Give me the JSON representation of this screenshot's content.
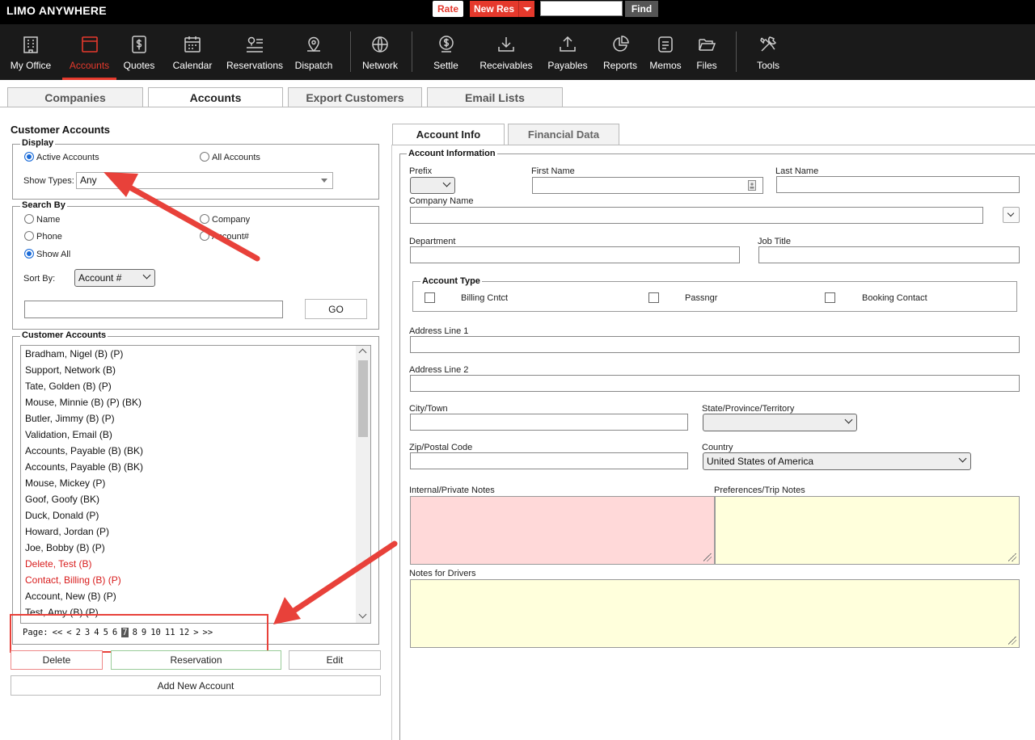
{
  "topbar": {
    "logo": "LIMO ANYWHERE",
    "rate_label": "Rate",
    "new_res_label": "New Res",
    "find_placeholder": "",
    "find_label": "Find"
  },
  "nav": {
    "items": [
      {
        "label": "My Office",
        "icon": "building-icon"
      },
      {
        "label": "Accounts",
        "icon": "accounts-window-icon",
        "active": true
      },
      {
        "label": "Quotes",
        "icon": "dollar-doc-icon"
      },
      {
        "label": "Calendar",
        "icon": "calendar-icon"
      },
      {
        "label": "Reservations",
        "icon": "reservations-list-icon"
      },
      {
        "label": "Dispatch",
        "icon": "location-pin-icon"
      },
      {
        "label": "Network",
        "icon": "globe-icon"
      },
      {
        "label": "Settle",
        "icon": "dollar-circle-icon"
      },
      {
        "label": "Receivables",
        "icon": "download-tray-icon"
      },
      {
        "label": "Payables",
        "icon": "upload-tray-icon"
      },
      {
        "label": "Reports",
        "icon": "pie-chart-icon"
      },
      {
        "label": "Memos",
        "icon": "memo-icon"
      },
      {
        "label": "Files",
        "icon": "folder-icon"
      },
      {
        "label": "Tools",
        "icon": "tools-icon"
      }
    ]
  },
  "tabs": [
    "Companies",
    "Accounts",
    "Export Customers",
    "Email Lists"
  ],
  "left": {
    "title": "Customer Accounts",
    "display": {
      "legend": "Display",
      "active_label": "Active Accounts",
      "all_label": "All Accounts",
      "show_types_label": "Show Types:",
      "show_types_value": "Any"
    },
    "search": {
      "legend": "Search By",
      "name_label": "Name",
      "company_label": "Company",
      "phone_label": "Phone",
      "account_label": "Account#",
      "show_all_label": "Show All",
      "sort_by_label": "Sort By:",
      "sort_by_value": "Account #",
      "search_value": "",
      "go_label": "GO"
    },
    "list": {
      "legend": "Customer Accounts",
      "items": [
        {
          "text": "Bradham, Nigel (B) (P)",
          "red": false
        },
        {
          "text": "Support, Network (B)",
          "red": false
        },
        {
          "text": "Tate, Golden (B) (P)",
          "red": false
        },
        {
          "text": "Mouse, Minnie (B) (P) (BK)",
          "red": false
        },
        {
          "text": "Butler, Jimmy (B) (P)",
          "red": false
        },
        {
          "text": "Validation, Email (B)",
          "red": false
        },
        {
          "text": "Accounts, Payable (B) (BK)",
          "red": false
        },
        {
          "text": "Accounts, Payable (B) (BK)",
          "red": false
        },
        {
          "text": "Mouse, Mickey (P)",
          "red": false
        },
        {
          "text": "Goof, Goofy (BK)",
          "red": false
        },
        {
          "text": "Duck, Donald (P)",
          "red": false
        },
        {
          "text": "Howard, Jordan (P)",
          "red": false
        },
        {
          "text": "Joe, Bobby (B) (P)",
          "red": false
        },
        {
          "text": "Delete, Test (B)",
          "red": true
        },
        {
          "text": "Contact, Billing (B) (P)",
          "red": true
        },
        {
          "text": "Account, New (B) (P)",
          "red": false
        },
        {
          "text": "Test, Amy (B) (P)",
          "red": false
        }
      ]
    },
    "pager": {
      "label": "Page:",
      "items": [
        "<<",
        "<",
        "2",
        "3",
        "4",
        "5",
        "6",
        "7",
        "8",
        "9",
        "10",
        "11",
        "12",
        ">",
        ">>"
      ],
      "current": "7"
    },
    "buttons": {
      "delete": "Delete",
      "reservation": "Reservation",
      "edit": "Edit",
      "add_new": "Add New Account"
    }
  },
  "right": {
    "tabs": [
      "Account Info",
      "Financial Data"
    ],
    "section": "Account Information",
    "labels": {
      "prefix": "Prefix",
      "first_name": "First Name",
      "last_name": "Last Name",
      "company_name": "Company Name",
      "department": "Department",
      "job_title": "Job Title",
      "account_type": "Account Type",
      "billing": "Billing Cntct",
      "passngr": "Passngr",
      "booking": "Booking Contact",
      "address1": "Address Line 1",
      "address2": "Address Line 2",
      "city": "City/Town",
      "state": "State/Province/Territory",
      "zip": "Zip/Postal Code",
      "country": "Country",
      "internal_notes": "Internal/Private Notes",
      "pref_notes": "Preferences/Trip Notes",
      "driver_notes": "Notes for Drivers"
    },
    "values": {
      "prefix": "",
      "state": "",
      "country": "United States of America"
    }
  },
  "colors": {
    "accent": "#e5392c",
    "internal_notes_bg": "#ffd9d9",
    "notes_bg": "#ffffdc",
    "annotation_arrow": "#e8413a"
  }
}
